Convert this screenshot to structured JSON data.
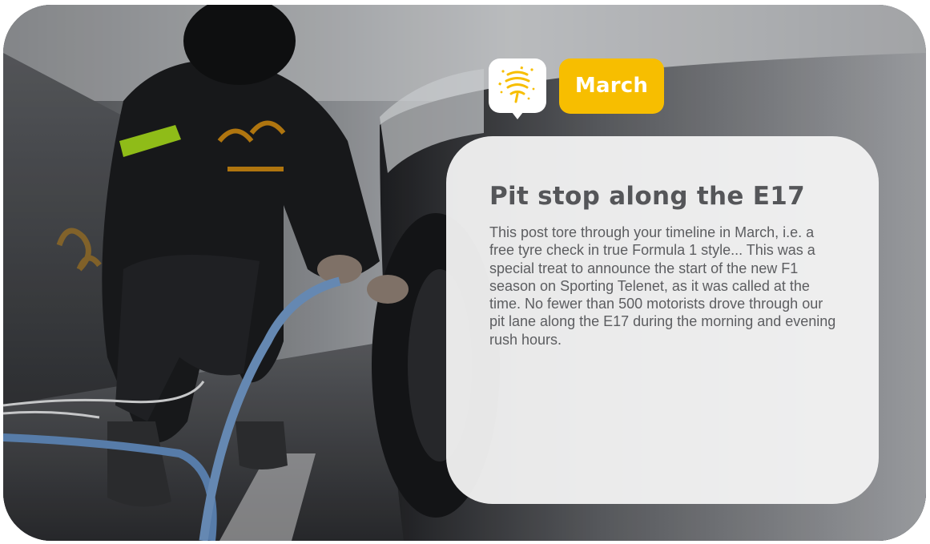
{
  "badge": {
    "month": "March",
    "icon": "confetti-streamer-icon",
    "color": "#f7be00"
  },
  "card": {
    "title": "Pit stop along the E17",
    "body": "This post tore through your timeline in March, i.e. a free tyre check in true Formula 1 style... This was a special treat to announce the start of the new F1 season on Sporting Telenet, as it was called at the time. No fewer than 500 motorists drove through our pit lane along the E17 during the morning and evening rush hours."
  },
  "photo": {
    "description_icon": "pit-stop-photo"
  }
}
